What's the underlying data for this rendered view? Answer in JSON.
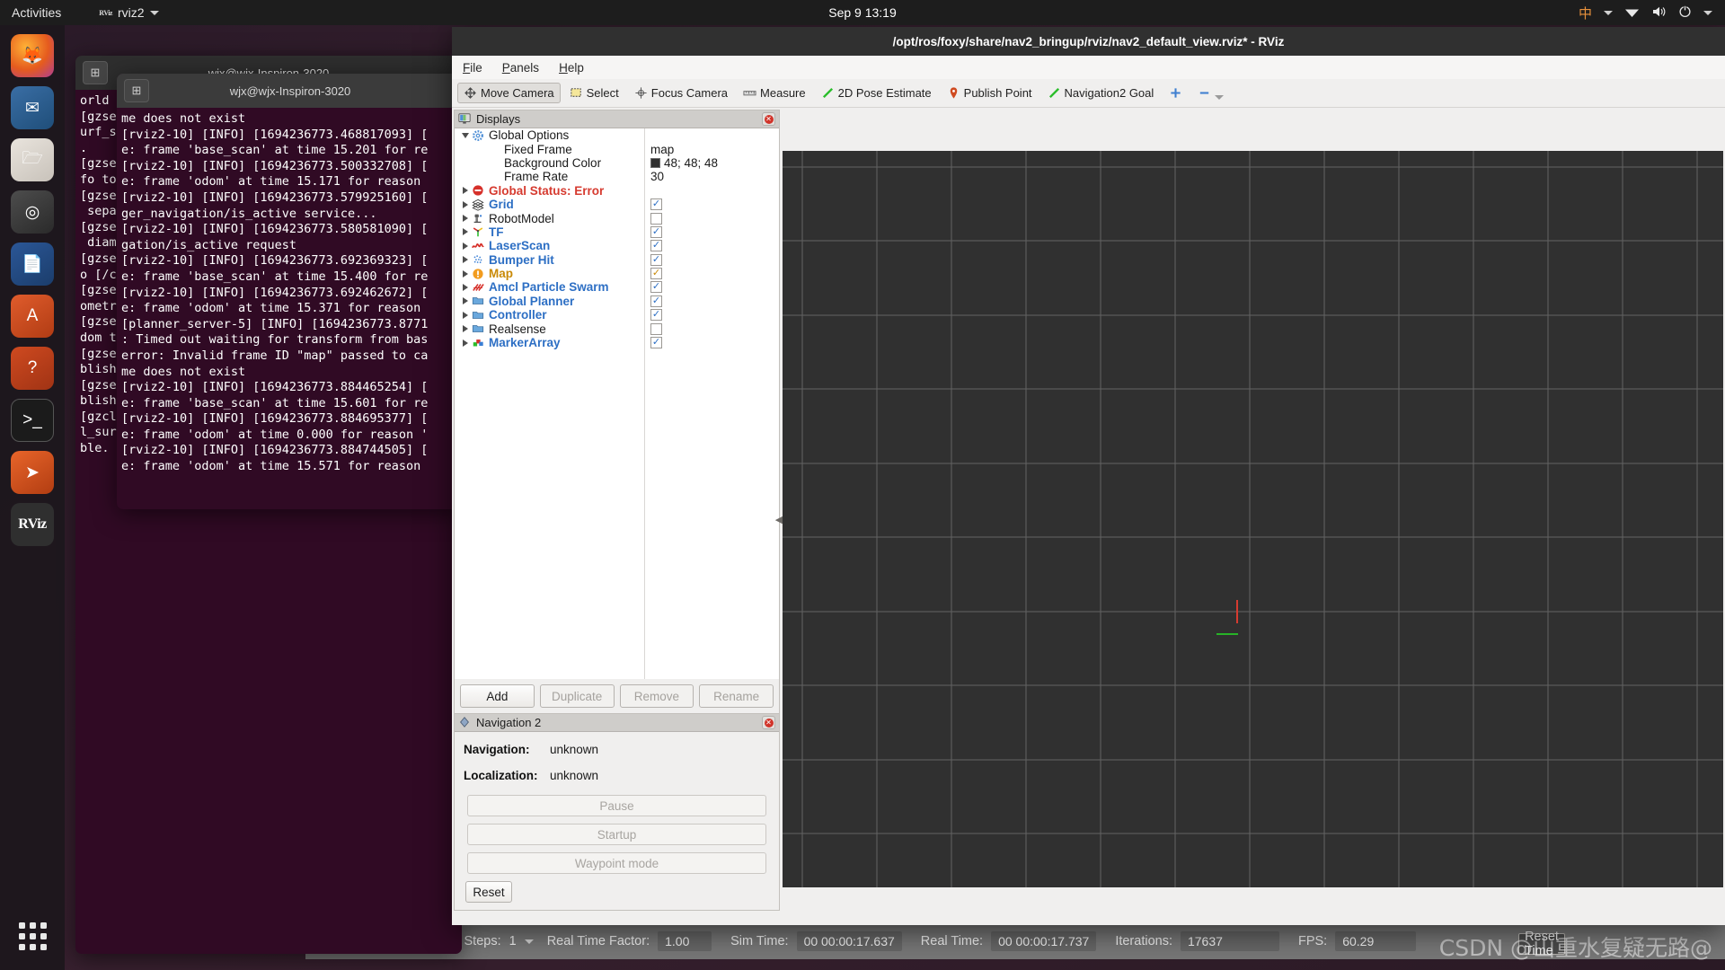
{
  "topbar": {
    "activities": "Activities",
    "app_name": "rviz2",
    "app_icon": "rviz-icon",
    "clock": "Sep 9  13:19",
    "input_method": "中",
    "icons": [
      "wifi-icon",
      "volume-icon",
      "power-icon",
      "chevron-down-icon"
    ]
  },
  "dock": {
    "items": [
      {
        "name": "firefox",
        "glyph": "🦊",
        "cls": "d-firefox"
      },
      {
        "name": "thunderbird",
        "glyph": "✉",
        "cls": "d-thunderbird"
      },
      {
        "name": "files",
        "glyph": "🗁",
        "cls": "d-files"
      },
      {
        "name": "rhythmbox",
        "glyph": "◎",
        "cls": "d-rhythmbox"
      },
      {
        "name": "libreoffice-writer",
        "glyph": "📄",
        "cls": "d-writer"
      },
      {
        "name": "ubuntu-software",
        "glyph": "A",
        "cls": "d-software"
      },
      {
        "name": "help",
        "glyph": "?",
        "cls": "d-help"
      },
      {
        "name": "terminal",
        "glyph": ">_",
        "cls": "d-term"
      },
      {
        "name": "vscode",
        "glyph": "➤",
        "cls": "d-vscode"
      },
      {
        "name": "rviz",
        "glyph": "RViz",
        "cls": "d-rviz"
      }
    ],
    "show_applications": "show-applications"
  },
  "terminal_back": {
    "title": "wjx@wjx-Inspiron-3020",
    "lines": "orld a\n[gzse\nurf_su\n.\n[gzse\nfo to \n[gzse\n sepa\n[gzse\n diam\n[gzse\no [/c\n[gzse\nometr\n[gzse\ndom t\n[gzse\nblish\n[gzse\nblish\n[gzcl\nl_sur\nble."
  },
  "terminal_front": {
    "title": "wjx@wjx-Inspiron-3020",
    "lines": "me does not exist\n[rviz2-10] [INFO] [1694236773.468817093] [\ne: frame 'base_scan' at time 15.201 for re\n[rviz2-10] [INFO] [1694236773.500332708] [\ne: frame 'odom' at time 15.171 for reason\n[rviz2-10] [INFO] [1694236773.579925160] [\nger_navigation/is_active service...\n[rviz2-10] [INFO] [1694236773.580581090] [\ngation/is_active request\n[rviz2-10] [INFO] [1694236773.692369323] [\ne: frame 'base_scan' at time 15.400 for re\n[rviz2-10] [INFO] [1694236773.692462672] [\ne: frame 'odom' at time 15.371 for reason\n[planner_server-5] [INFO] [1694236773.8771\n: Timed out waiting for transform from bas\nerror: Invalid frame ID \"map\" passed to ca\nme does not exist\n[rviz2-10] [INFO] [1694236773.884465254] [\ne: frame 'base_scan' at time 15.601 for re\n[rviz2-10] [INFO] [1694236773.884695377] [\ne: frame 'odom' at time 0.000 for reason '\n[rviz2-10] [INFO] [1694236773.884744505] [\ne: frame 'odom' at time 15.571 for reason"
  },
  "rviz": {
    "title": "/opt/ros/foxy/share/nav2_bringup/rviz/nav2_default_view.rviz* - RViz",
    "menu": [
      "File",
      "Panels",
      "Help"
    ],
    "toolbar": [
      {
        "label": "Move Camera",
        "icon": "move-camera-icon",
        "active": true
      },
      {
        "label": "Select",
        "icon": "select-icon",
        "active": false
      },
      {
        "label": "Focus Camera",
        "icon": "focus-camera-icon",
        "active": false
      },
      {
        "label": "Measure",
        "icon": "measure-icon",
        "active": false
      },
      {
        "label": "2D Pose Estimate",
        "icon": "pose-estimate-icon",
        "active": false
      },
      {
        "label": "Publish Point",
        "icon": "publish-point-icon",
        "active": false
      },
      {
        "label": "Navigation2 Goal",
        "icon": "nav2-goal-icon",
        "active": false
      }
    ],
    "toolbar_extra": [
      "plus-icon",
      "minus-icon"
    ],
    "displays": {
      "panel_title": "Displays",
      "rows": [
        {
          "label": "Global Options",
          "icon": "gear-icon",
          "style": "plain",
          "twisty": "open",
          "indent": 0,
          "control": "none"
        },
        {
          "label": "Fixed Frame",
          "icon": "none",
          "style": "plain",
          "twisty": "none",
          "indent": 1,
          "control": "text",
          "value": "map"
        },
        {
          "label": "Background Color",
          "icon": "none",
          "style": "plain",
          "twisty": "none",
          "indent": 1,
          "control": "color",
          "value": "48; 48; 48"
        },
        {
          "label": "Frame Rate",
          "icon": "none",
          "style": "plain",
          "twisty": "none",
          "indent": 1,
          "control": "text",
          "value": "30"
        },
        {
          "label": "Global Status: Error",
          "icon": "error-icon",
          "style": "err",
          "twisty": "closed",
          "indent": 0,
          "control": "none"
        },
        {
          "label": "Grid",
          "icon": "grid-icon",
          "style": "link",
          "twisty": "closed",
          "indent": 0,
          "control": "checkbox",
          "checked": true
        },
        {
          "label": "RobotModel",
          "icon": "robot-icon",
          "style": "plain",
          "twisty": "closed",
          "indent": 0,
          "control": "checkbox",
          "checked": false
        },
        {
          "label": "TF",
          "icon": "tf-icon",
          "style": "link",
          "twisty": "closed",
          "indent": 0,
          "control": "checkbox",
          "checked": true
        },
        {
          "label": "LaserScan",
          "icon": "laserscan-icon",
          "style": "link",
          "twisty": "closed",
          "indent": 0,
          "control": "checkbox",
          "checked": true
        },
        {
          "label": "Bumper Hit",
          "icon": "pointcloud-icon",
          "style": "link",
          "twisty": "closed",
          "indent": 0,
          "control": "checkbox",
          "checked": true
        },
        {
          "label": "Map",
          "icon": "warn-icon",
          "style": "warn",
          "twisty": "closed",
          "indent": 0,
          "control": "checkbox",
          "checked": true,
          "amber": true
        },
        {
          "label": "Amcl Particle Swarm",
          "icon": "poses-icon",
          "style": "link",
          "twisty": "closed",
          "indent": 0,
          "control": "checkbox",
          "checked": true
        },
        {
          "label": "Global Planner",
          "icon": "folder-icon",
          "style": "link",
          "twisty": "closed",
          "indent": 0,
          "control": "checkbox",
          "checked": true
        },
        {
          "label": "Controller",
          "icon": "folder-icon",
          "style": "link",
          "twisty": "closed",
          "indent": 0,
          "control": "checkbox",
          "checked": true
        },
        {
          "label": "Realsense",
          "icon": "folder-icon",
          "style": "plain",
          "twisty": "closed",
          "indent": 0,
          "control": "checkbox",
          "checked": false
        },
        {
          "label": "MarkerArray",
          "icon": "marker-icon",
          "style": "link",
          "twisty": "closed",
          "indent": 0,
          "control": "checkbox",
          "checked": true
        }
      ],
      "buttons": [
        {
          "label": "Add",
          "enabled": true
        },
        {
          "label": "Duplicate",
          "enabled": false
        },
        {
          "label": "Remove",
          "enabled": false
        },
        {
          "label": "Rename",
          "enabled": false
        }
      ]
    },
    "navigation2": {
      "panel_title": "Navigation 2",
      "fields": [
        {
          "label": "Navigation:",
          "value": "unknown"
        },
        {
          "label": "Localization:",
          "value": "unknown"
        }
      ],
      "buttons": [
        {
          "label": "Pause",
          "enabled": false
        },
        {
          "label": "Startup",
          "enabled": false
        },
        {
          "label": "Waypoint mode",
          "enabled": false
        }
      ],
      "reset_label": "Reset"
    }
  },
  "gazebo_statusbar": {
    "pause_icon": "pause-icon",
    "step_icon": "step-icon",
    "steps_label": "Steps:",
    "steps_value": "1",
    "rtf_label": "Real Time Factor:",
    "rtf_value": "1.00",
    "sim_time_label": "Sim Time:",
    "sim_time_value": "00 00:00:17.637",
    "real_time_label": "Real Time:",
    "real_time_value": "00 00:00:17.737",
    "iterations_label": "Iterations:",
    "iterations_value": "17637",
    "fps_label": "FPS:",
    "fps_value": "60.29",
    "reset_label": "Reset Time"
  },
  "watermark": "CSDN @山重水复疑无路@",
  "colors": {
    "accent_link": "#2d6fc4",
    "error": "#d63b30",
    "warn": "#c98a08",
    "viewport_bg": "#303030",
    "axis_x_red": "#d63b30",
    "axis_y_green": "#27b327"
  }
}
